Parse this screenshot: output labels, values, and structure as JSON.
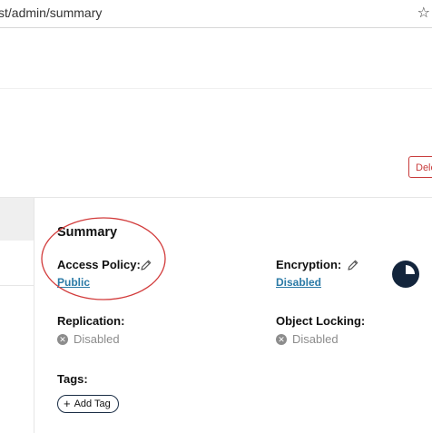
{
  "browser": {
    "url": "st/admin/summary"
  },
  "actions": {
    "delete_label": "Dele"
  },
  "summary": {
    "title": "Summary",
    "access_policy": {
      "label": "Access Policy:",
      "value": "Public"
    },
    "encryption": {
      "label": "Encryption:",
      "value": "Disabled"
    },
    "replication": {
      "label": "Replication:",
      "value": "Disabled"
    },
    "object_locking": {
      "label": "Object Locking:",
      "value": "Disabled"
    },
    "tags": {
      "label": "Tags:",
      "add_label": "Add Tag"
    }
  },
  "colors": {
    "link": "#2b7aa6",
    "delete": "#c83b3b",
    "annotation": "#d23b3b",
    "pie_dark": "#13253c"
  },
  "icons": {
    "star": "star-icon",
    "pencil": "pencil-icon",
    "disabled": "x-circle-icon",
    "usage": "pie-chart-icon",
    "add": "plus-icon"
  }
}
